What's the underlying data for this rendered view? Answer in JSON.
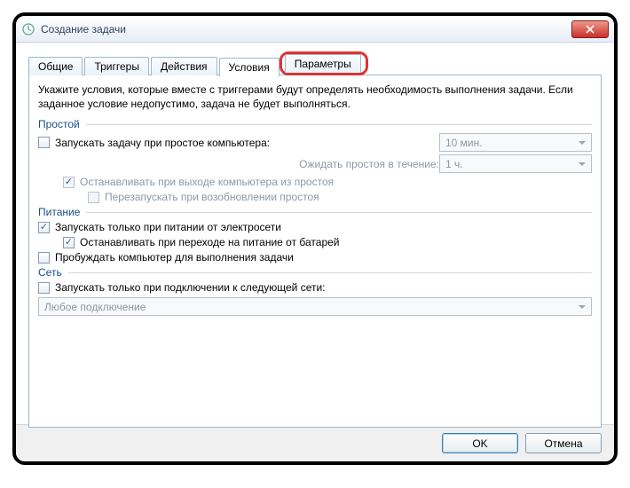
{
  "window": {
    "title": "Создание задачи"
  },
  "tabs": {
    "general": "Общие",
    "triggers": "Триггеры",
    "actions": "Действия",
    "conditions": "Условия",
    "settings": "Параметры"
  },
  "intro": "Укажите условия, которые вместе с триггерами будут определять необходимость выполнения задачи. Если заданное условие недопустимо, задача не будет выполняться.",
  "groups": {
    "idle": {
      "title": "Простой",
      "start_on_idle": "Запускать задачу при простое компьютера:",
      "idle_duration": "10 мин.",
      "wait_label": "Ожидать простоя в течение:",
      "wait_duration": "1 ч.",
      "stop_on_end": "Останавливать при выходе компьютера из простоя",
      "restart_on_resume": "Перезапускать при возобновлении простоя"
    },
    "power": {
      "title": "Питание",
      "only_ac": "Запускать только при питании от электросети",
      "stop_on_battery": "Останавливать при переходе на питание от батарей",
      "wake": "Пробуждать компьютер для выполнения задачи"
    },
    "network": {
      "title": "Сеть",
      "only_network": "Запускать только при подключении к следующей сети:",
      "any_connection": "Любое подключение"
    }
  },
  "buttons": {
    "ok": "OK",
    "cancel": "Отмена"
  }
}
